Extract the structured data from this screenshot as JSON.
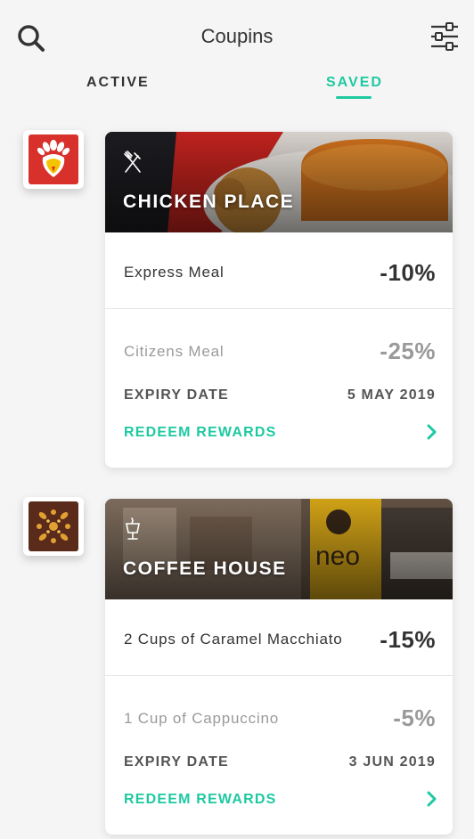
{
  "header": {
    "title": "Coupins",
    "search_icon": "search-icon",
    "filter_icon": "sliders-icon"
  },
  "tabs": [
    {
      "label": "ACTIVE",
      "selected": false
    },
    {
      "label": "SAVED",
      "selected": true
    }
  ],
  "colors": {
    "accent": "#1ec9a1",
    "text_dark": "#333333",
    "text_dim": "#9a9a9a",
    "chicken_brand": "#d8302a",
    "coffee_brand": "#5a2a1a"
  },
  "coupons": [
    {
      "name": "CHICKEN PLACE",
      "category_icon": "fork-knife-icon",
      "logo_icon": "chicken-logo-icon",
      "offers": [
        {
          "title": "Express Meal",
          "discount": "-10%",
          "highlighted": true
        },
        {
          "title": "Citizens Meal",
          "discount": "-25%",
          "highlighted": false
        }
      ],
      "expiry_label": "EXPIRY DATE",
      "expiry_date": "5 MAY 2019",
      "redeem_label": "REDEEM REWARDS"
    },
    {
      "name": "COFFEE HOUSE",
      "category_icon": "coffee-cup-icon",
      "logo_icon": "coffee-logo-icon",
      "offers": [
        {
          "title": "2 Cups of Caramel Macchiato",
          "discount": "-15%",
          "highlighted": true
        },
        {
          "title": "1 Cup of Cappuccino",
          "discount": "-5%",
          "highlighted": false
        }
      ],
      "expiry_label": "EXPIRY DATE",
      "expiry_date": "3 JUN 2019",
      "redeem_label": "REDEEM REWARDS"
    }
  ]
}
